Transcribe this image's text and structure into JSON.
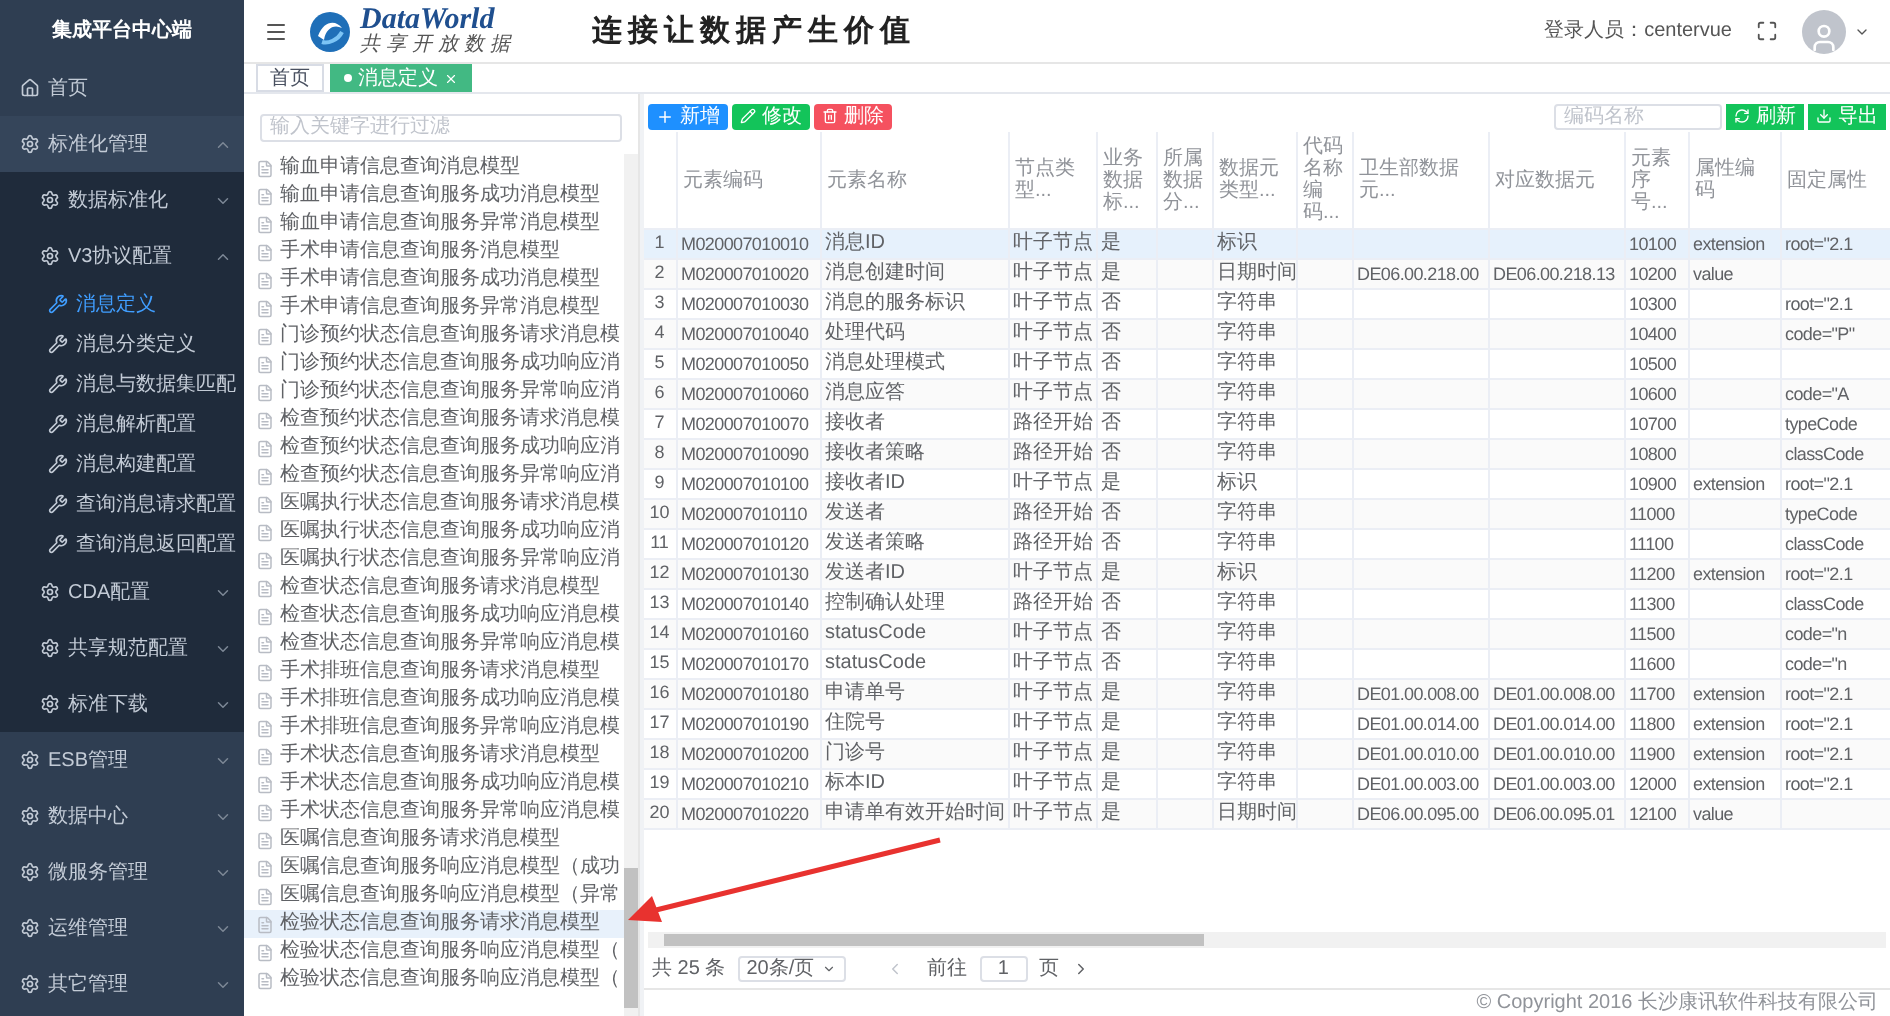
{
  "sidebar": {
    "title": "集成平台中心端",
    "items": [
      {
        "label": "首页",
        "kind": "home",
        "selected": false
      },
      {
        "label": "标准化管理",
        "kind": "group",
        "expanded": true,
        "selected": false,
        "children": [
          {
            "label": "数据标准化",
            "kind": "group",
            "expanded": false,
            "selected": false
          },
          {
            "label": "V3协议配置",
            "kind": "group",
            "expanded": true,
            "selected": false,
            "children": [
              {
                "label": "消息定义",
                "kind": "leaf",
                "selected": true
              },
              {
                "label": "消息分类定义",
                "kind": "leaf",
                "selected": false
              },
              {
                "label": "消息与数据集匹配",
                "kind": "leaf",
                "selected": false
              },
              {
                "label": "消息解析配置",
                "kind": "leaf",
                "selected": false
              },
              {
                "label": "消息构建配置",
                "kind": "leaf",
                "selected": false
              },
              {
                "label": "查询消息请求配置",
                "kind": "leaf",
                "selected": false
              },
              {
                "label": "查询消息返回配置",
                "kind": "leaf",
                "selected": false
              }
            ]
          },
          {
            "label": "CDA配置",
            "kind": "group",
            "expanded": false,
            "selected": false
          },
          {
            "label": "共享规范配置",
            "kind": "group",
            "expanded": false,
            "selected": false
          },
          {
            "label": "标准下载",
            "kind": "group",
            "expanded": false,
            "selected": false
          }
        ]
      },
      {
        "label": "ESB管理",
        "kind": "group",
        "expanded": false,
        "selected": false
      },
      {
        "label": "数据中心",
        "kind": "group",
        "expanded": false,
        "selected": false
      },
      {
        "label": "微服务管理",
        "kind": "group",
        "expanded": false,
        "selected": false
      },
      {
        "label": "运维管理",
        "kind": "group",
        "expanded": false,
        "selected": false
      },
      {
        "label": "其它管理",
        "kind": "group",
        "expanded": false,
        "selected": false
      }
    ]
  },
  "header": {
    "logo_text": "DataWorld",
    "logo_subtitle": "共享开放数据",
    "slogan": "连接让数据产生价值",
    "user_label": "登录人员：centervue"
  },
  "tabs": [
    {
      "label": "首页",
      "selected": false
    },
    {
      "label": "消息定义",
      "selected": true
    }
  ],
  "tree": {
    "placeholder": "输入关键字进行过滤",
    "items": [
      {
        "label": "输血申请信息查询消息模型",
        "selected": false
      },
      {
        "label": "输血申请信息查询服务成功消息模型",
        "selected": false
      },
      {
        "label": "输血申请信息查询服务异常消息模型",
        "selected": false
      },
      {
        "label": "手术申请信息查询服务消息模型",
        "selected": false
      },
      {
        "label": "手术申请信息查询服务成功消息模型",
        "selected": false
      },
      {
        "label": "手术申请信息查询服务异常消息模型",
        "selected": false
      },
      {
        "label": "门诊预约状态信息查询服务请求消息模",
        "selected": false
      },
      {
        "label": "门诊预约状态信息查询服务成功响应消",
        "selected": false
      },
      {
        "label": "门诊预约状态信息查询服务异常响应消",
        "selected": false
      },
      {
        "label": "检查预约状态信息查询服务请求消息模",
        "selected": false
      },
      {
        "label": "检查预约状态信息查询服务成功响应消",
        "selected": false
      },
      {
        "label": "检查预约状态信息查询服务异常响应消",
        "selected": false
      },
      {
        "label": "医嘱执行状态信息查询服务请求消息模",
        "selected": false
      },
      {
        "label": "医嘱执行状态信息查询服务成功响应消",
        "selected": false
      },
      {
        "label": "医嘱执行状态信息查询服务异常响应消",
        "selected": false
      },
      {
        "label": "检查状态信息查询服务请求消息模型",
        "selected": false
      },
      {
        "label": "检查状态信息查询服务成功响应消息模",
        "selected": false
      },
      {
        "label": "检查状态信息查询服务异常响应消息模",
        "selected": false
      },
      {
        "label": "手术排班信息查询服务请求消息模型",
        "selected": false
      },
      {
        "label": "手术排班信息查询服务成功响应消息模",
        "selected": false
      },
      {
        "label": "手术排班信息查询服务异常响应消息模",
        "selected": false
      },
      {
        "label": "手术状态信息查询服务请求消息模型",
        "selected": false
      },
      {
        "label": "手术状态信息查询服务成功响应消息模",
        "selected": false
      },
      {
        "label": "手术状态信息查询服务异常响应消息模",
        "selected": false
      },
      {
        "label": "医嘱信息查询服务请求消息模型",
        "selected": false
      },
      {
        "label": "医嘱信息查询服务响应消息模型（成功",
        "selected": false
      },
      {
        "label": "医嘱信息查询服务响应消息模型（异常",
        "selected": false
      },
      {
        "label": "检验状态信息查询服务请求消息模型",
        "selected": true
      },
      {
        "label": "检验状态信息查询服务响应消息模型（",
        "selected": false
      },
      {
        "label": "检验状态信息查询服务响应消息模型（",
        "selected": false
      }
    ]
  },
  "toolbar": {
    "buttons": [
      {
        "label": "新增",
        "kind": "add"
      },
      {
        "label": "修改",
        "kind": "edit"
      },
      {
        "label": "删除",
        "kind": "delete"
      }
    ],
    "search": {
      "placeholder": "编码名称"
    },
    "right_buttons": [
      {
        "label": "刷新",
        "kind": "refresh"
      },
      {
        "label": "导出",
        "kind": "export"
      }
    ]
  },
  "table": {
    "columns": [
      "元素编码",
      "元素名称",
      "节点类型...",
      "业务数据标...",
      "所属数据分...",
      "数据元类型...",
      "代码名称编码...",
      "卫生部数据元...",
      "对应数据元",
      "元素序号...",
      "属性编码",
      "固定属性"
    ],
    "rows": [
      {
        "index": "1",
        "selected": true,
        "cells": [
          "M020007010010",
          "消息ID",
          "叶子节点",
          "是",
          "",
          "标识",
          "",
          "",
          "",
          "10100",
          "extension",
          "root=\"2.1"
        ]
      },
      {
        "index": "2",
        "selected": false,
        "cells": [
          "M020007010020",
          "消息创建时间",
          "叶子节点",
          "是",
          "",
          "日期时间",
          "",
          "DE06.00.218.00",
          "DE06.00.218.13",
          "10200",
          "value",
          ""
        ]
      },
      {
        "index": "3",
        "selected": false,
        "cells": [
          "M020007010030",
          "消息的服务标识",
          "叶子节点",
          "否",
          "",
          "字符串",
          "",
          "",
          "",
          "10300",
          "",
          "root=\"2.1"
        ]
      },
      {
        "index": "4",
        "selected": false,
        "cells": [
          "M020007010040",
          "处理代码",
          "叶子节点",
          "否",
          "",
          "字符串",
          "",
          "",
          "",
          "10400",
          "",
          "code=\"P\""
        ]
      },
      {
        "index": "5",
        "selected": false,
        "cells": [
          "M020007010050",
          "消息处理模式",
          "叶子节点",
          "否",
          "",
          "字符串",
          "",
          "",
          "",
          "10500",
          "",
          ""
        ]
      },
      {
        "index": "6",
        "selected": false,
        "cells": [
          "M020007010060",
          "消息应答",
          "叶子节点",
          "否",
          "",
          "字符串",
          "",
          "",
          "",
          "10600",
          "",
          "code=\"A"
        ]
      },
      {
        "index": "7",
        "selected": false,
        "cells": [
          "M020007010070",
          "接收者",
          "路径开始",
          "否",
          "",
          "字符串",
          "",
          "",
          "",
          "10700",
          "",
          "typeCode"
        ]
      },
      {
        "index": "8",
        "selected": false,
        "cells": [
          "M020007010090",
          "接收者策略",
          "路径开始",
          "否",
          "",
          "字符串",
          "",
          "",
          "",
          "10800",
          "",
          "classCode"
        ]
      },
      {
        "index": "9",
        "selected": false,
        "cells": [
          "M020007010100",
          "接收者ID",
          "叶子节点",
          "是",
          "",
          "标识",
          "",
          "",
          "",
          "10900",
          "extension",
          "root=\"2.1"
        ]
      },
      {
        "index": "10",
        "selected": false,
        "cells": [
          "M020007010110",
          "发送者",
          "路径开始",
          "否",
          "",
          "字符串",
          "",
          "",
          "",
          "11000",
          "",
          "typeCode"
        ]
      },
      {
        "index": "11",
        "selected": false,
        "cells": [
          "M020007010120",
          "发送者策略",
          "路径开始",
          "否",
          "",
          "字符串",
          "",
          "",
          "",
          "11100",
          "",
          "classCode"
        ]
      },
      {
        "index": "12",
        "selected": false,
        "cells": [
          "M020007010130",
          "发送者ID",
          "叶子节点",
          "是",
          "",
          "标识",
          "",
          "",
          "",
          "11200",
          "extension",
          "root=\"2.1"
        ]
      },
      {
        "index": "13",
        "selected": false,
        "cells": [
          "M020007010140",
          "控制确认处理",
          "路径开始",
          "否",
          "",
          "字符串",
          "",
          "",
          "",
          "11300",
          "",
          "classCode"
        ]
      },
      {
        "index": "14",
        "selected": false,
        "cells": [
          "M020007010160",
          "statusCode",
          "叶子节点",
          "否",
          "",
          "字符串",
          "",
          "",
          "",
          "11500",
          "",
          "code=\"n"
        ]
      },
      {
        "index": "15",
        "selected": false,
        "cells": [
          "M020007010170",
          "statusCode",
          "叶子节点",
          "否",
          "",
          "字符串",
          "",
          "",
          "",
          "11600",
          "",
          "code=\"n"
        ]
      },
      {
        "index": "16",
        "selected": false,
        "cells": [
          "M020007010180",
          "申请单号",
          "叶子节点",
          "是",
          "",
          "字符串",
          "",
          "DE01.00.008.00",
          "DE01.00.008.00",
          "11700",
          "extension",
          "root=\"2.1"
        ]
      },
      {
        "index": "17",
        "selected": false,
        "cells": [
          "M020007010190",
          "住院号",
          "叶子节点",
          "是",
          "",
          "字符串",
          "",
          "DE01.00.014.00",
          "DE01.00.014.00",
          "11800",
          "extension",
          "root=\"2.1"
        ]
      },
      {
        "index": "18",
        "selected": false,
        "cells": [
          "M020007010200",
          "门诊号",
          "叶子节点",
          "是",
          "",
          "字符串",
          "",
          "DE01.00.010.00",
          "DE01.00.010.00",
          "11900",
          "extension",
          "root=\"2.1"
        ]
      },
      {
        "index": "19",
        "selected": false,
        "cells": [
          "M020007010210",
          "标本ID",
          "叶子节点",
          "是",
          "",
          "字符串",
          "",
          "DE01.00.003.00",
          "DE01.00.003.00",
          "12000",
          "extension",
          "root=\"2.1"
        ]
      },
      {
        "index": "20",
        "selected": false,
        "cells": [
          "M020007010220",
          "申请单有效开始时间",
          "叶子节点",
          "是",
          "",
          "日期时间",
          "",
          "DE06.00.095.00",
          "DE06.00.095.01",
          "12100",
          "value",
          ""
        ]
      }
    ]
  },
  "pagination": {
    "total": "共 25 条",
    "page_size": "20条/页",
    "goto_label": "前往",
    "page": "1",
    "page_suffix": "页"
  },
  "footer": {
    "copyright": "© Copyright 2016 长沙康讯软件科技有限公司"
  }
}
